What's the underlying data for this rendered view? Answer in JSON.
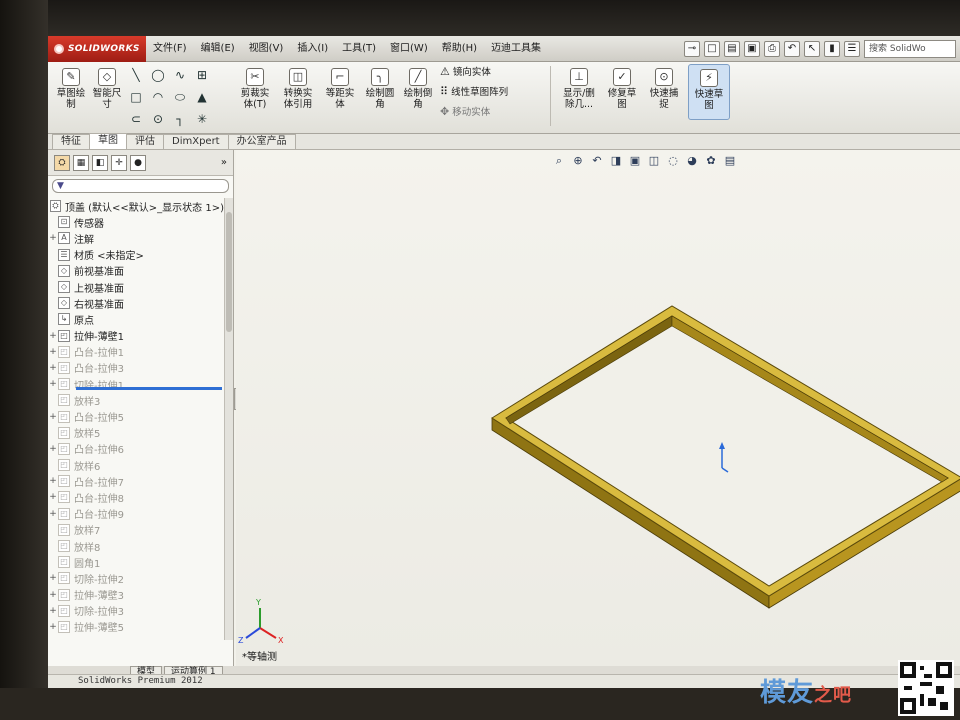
{
  "app": {
    "brand": "SOLIDWORKS",
    "status_text": "SolidWorks Premium 2012"
  },
  "menu": {
    "items": [
      "文件(F)",
      "编辑(E)",
      "视图(V)",
      "插入(I)",
      "工具(T)",
      "窗口(W)",
      "帮助(H)",
      "迈迪工具集"
    ],
    "search_placeholder": "搜索 SolidWo"
  },
  "command_manager": {
    "sketch": "草图绘\n制",
    "smart_dimension": "智能尺\n寸",
    "trim": "剪裁实\n体(T)",
    "convert": "转换实\n体引用",
    "offset": "等距实\n体",
    "fillet": "绘制圆\n角",
    "chamfer": "绘制倒\n角",
    "mirror": "镜向实体",
    "linear_pattern": "线性草图阵列",
    "move": "移动实体",
    "display_delete": "显示/删\n除几...",
    "repair": "修复草\n图",
    "quick_snap": "快速捕\n捉",
    "rapid_sketch": "快速草\n图"
  },
  "tabs": [
    "特征",
    "草图",
    "评估",
    "DimXpert",
    "办公室产品"
  ],
  "active_tab": "草图",
  "feature_tree": {
    "root": "顶盖  (默认<<默认>_显示状态 1>)",
    "items": [
      {
        "label": "传感器",
        "expand": "",
        "dim": false
      },
      {
        "label": "注解",
        "expand": "+",
        "dim": false
      },
      {
        "label": "材质 <未指定>",
        "expand": "",
        "dim": false
      },
      {
        "label": "前视基准面",
        "expand": "",
        "dim": false
      },
      {
        "label": "上视基准面",
        "expand": "",
        "dim": false
      },
      {
        "label": "右视基准面",
        "expand": "",
        "dim": false
      },
      {
        "label": "原点",
        "expand": "",
        "dim": false
      },
      {
        "label": "拉伸-薄壁1",
        "expand": "+",
        "dim": false
      },
      {
        "label": "凸台-拉伸1",
        "expand": "+",
        "dim": true
      },
      {
        "label": "凸台-拉伸3",
        "expand": "+",
        "dim": true
      },
      {
        "label": "切除-拉伸1",
        "expand": "+",
        "dim": true
      },
      {
        "label": "放样3",
        "expand": "",
        "dim": true
      },
      {
        "label": "凸台-拉伸5",
        "expand": "+",
        "dim": true
      },
      {
        "label": "放样5",
        "expand": "",
        "dim": true
      },
      {
        "label": "凸台-拉伸6",
        "expand": "+",
        "dim": true
      },
      {
        "label": "放样6",
        "expand": "",
        "dim": true
      },
      {
        "label": "凸台-拉伸7",
        "expand": "+",
        "dim": true
      },
      {
        "label": "凸台-拉伸8",
        "expand": "+",
        "dim": true
      },
      {
        "label": "凸台-拉伸9",
        "expand": "+",
        "dim": true
      },
      {
        "label": "放样7",
        "expand": "",
        "dim": true
      },
      {
        "label": "放样8",
        "expand": "",
        "dim": true
      },
      {
        "label": "圆角1",
        "expand": "",
        "dim": true
      },
      {
        "label": "切除-拉伸2",
        "expand": "+",
        "dim": true
      },
      {
        "label": "拉伸-薄壁3",
        "expand": "+",
        "dim": true
      },
      {
        "label": "切除-拉伸3",
        "expand": "+",
        "dim": true
      },
      {
        "label": "拉伸-薄壁5",
        "expand": "+",
        "dim": true
      }
    ]
  },
  "viewport": {
    "view_label": "*等轴测"
  },
  "bottom_tabs": [
    "模型",
    "运动算例 1"
  ],
  "watermark": {
    "text": "模友",
    "sub": "之吧"
  },
  "colors": {
    "model_gold": "#c9a92e",
    "model_dark": "#6e5a12",
    "rollback_bar": "#2f6fd4",
    "brand_red": "#c22a1c"
  }
}
